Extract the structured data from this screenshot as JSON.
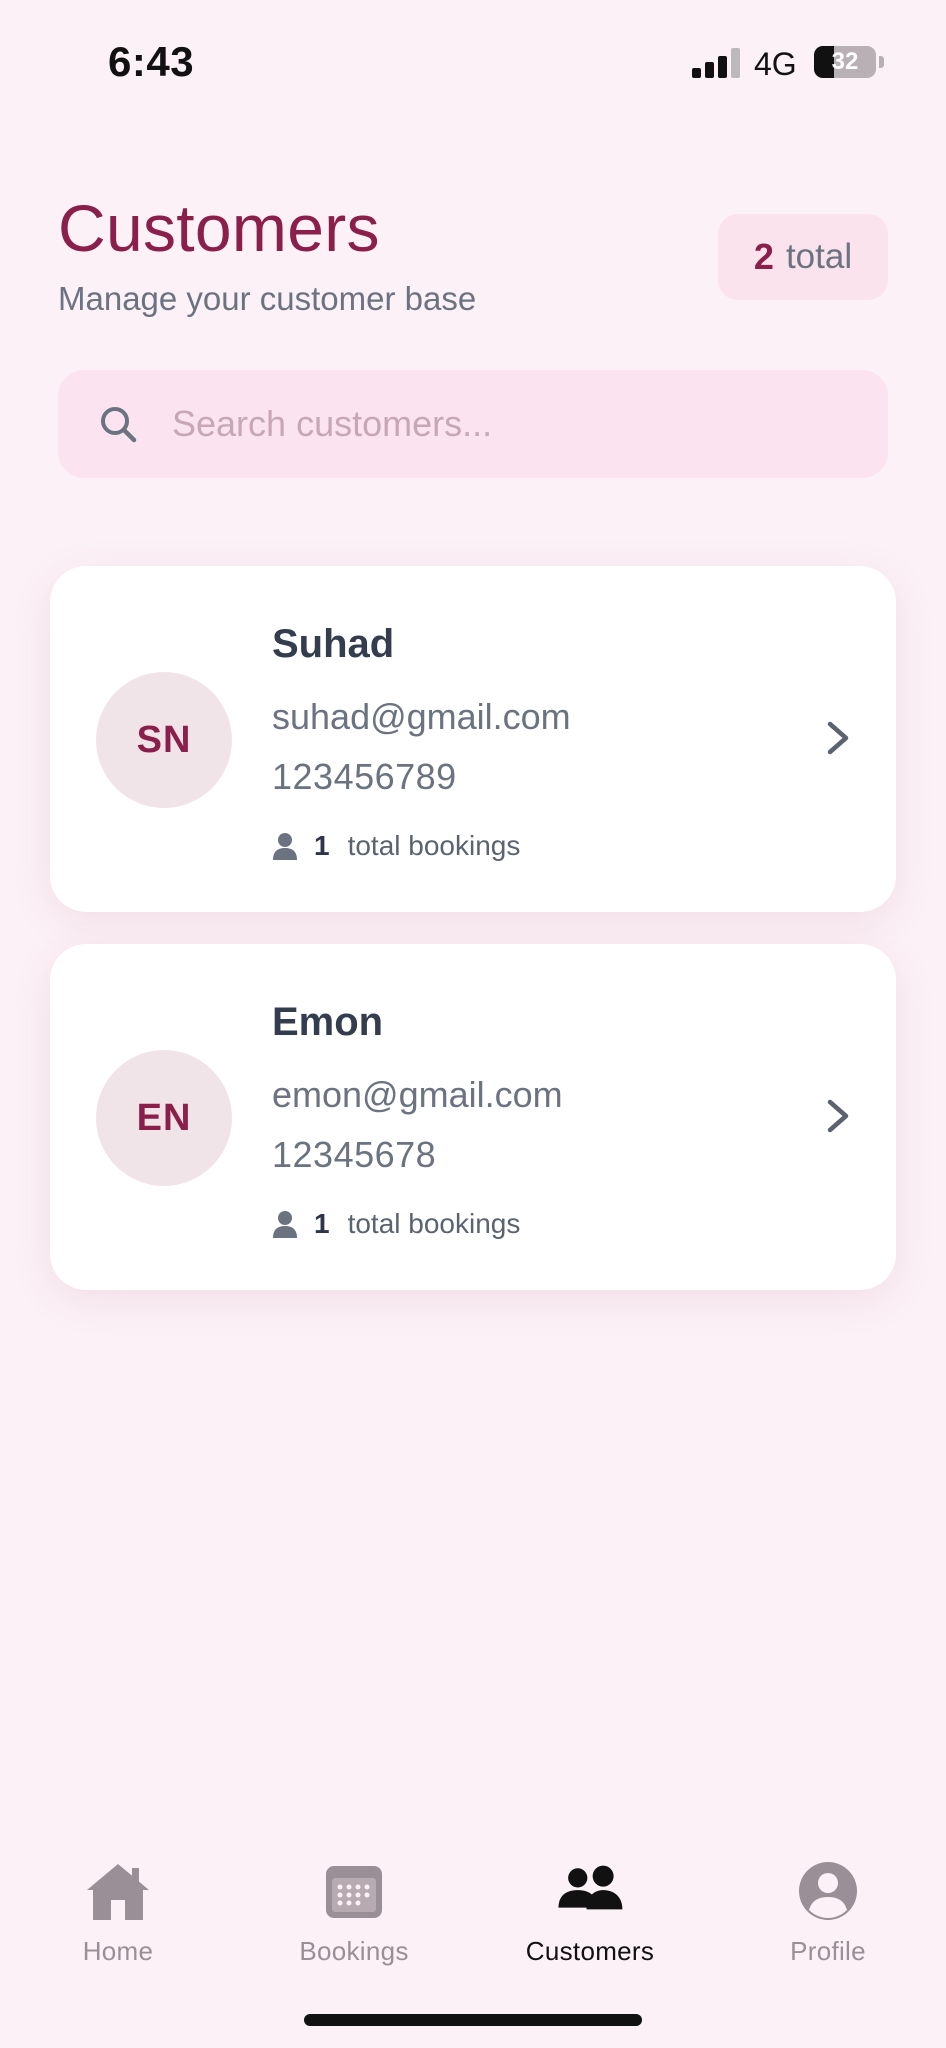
{
  "status_bar": {
    "time": "6:43",
    "network": "4G",
    "battery": "32"
  },
  "header": {
    "title": "Customers",
    "subtitle": "Manage your customer base",
    "total_count": "2",
    "total_label": "total"
  },
  "search": {
    "placeholder": "Search customers...",
    "value": ""
  },
  "customers": [
    {
      "initials": "SN",
      "name": "Suhad",
      "email": "suhad@gmail.com",
      "phone": "123456789",
      "bookings_count": "1",
      "bookings_label": "total bookings"
    },
    {
      "initials": "EN",
      "name": "Emon",
      "email": "emon@gmail.com",
      "phone": "12345678",
      "bookings_count": "1",
      "bookings_label": "total bookings"
    }
  ],
  "nav": {
    "items": [
      {
        "label": "Home",
        "icon": "home-icon"
      },
      {
        "label": "Bookings",
        "icon": "calendar-icon"
      },
      {
        "label": "Customers",
        "icon": "people-icon"
      },
      {
        "label": "Profile",
        "icon": "profile-icon"
      }
    ],
    "active": "Customers"
  },
  "colors": {
    "accent": "#8a1f4b",
    "background": "#fcf1f7",
    "search_bg": "#fbe4ef",
    "avatar_bg": "#f1e4e9",
    "inactive_nav": "#9a8f96"
  }
}
